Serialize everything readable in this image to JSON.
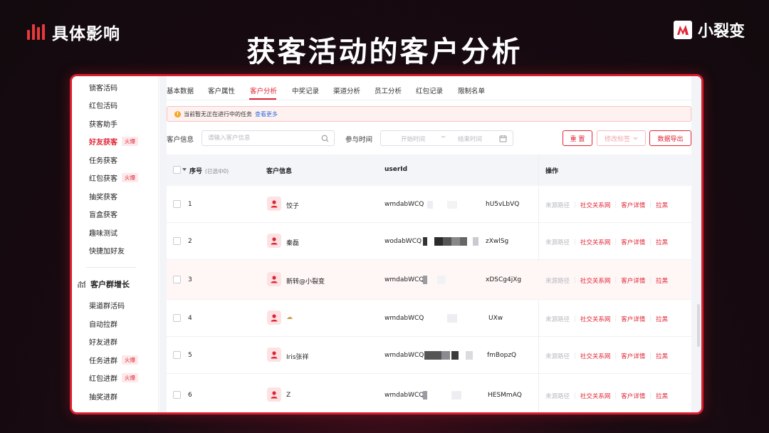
{
  "slide": {
    "brand_left": "具体影响",
    "title": "获客活动的客户分析",
    "brand_right": "小裂变"
  },
  "sidebar": {
    "items_top": [
      {
        "label": "锁客活码",
        "active": false,
        "hot": ""
      },
      {
        "label": "红包活码",
        "active": false,
        "hot": ""
      },
      {
        "label": "获客助手",
        "active": false,
        "hot": ""
      },
      {
        "label": "好友获客",
        "active": true,
        "hot": "火爆"
      },
      {
        "label": "任务获客",
        "active": false,
        "hot": ""
      },
      {
        "label": "红包获客",
        "active": false,
        "hot": "火爆"
      },
      {
        "label": "抽奖获客",
        "active": false,
        "hot": ""
      },
      {
        "label": "盲盒获客",
        "active": false,
        "hot": ""
      },
      {
        "label": "趣味测试",
        "active": false,
        "hot": ""
      },
      {
        "label": "快捷加好友",
        "active": false,
        "hot": ""
      }
    ],
    "group_title": "客户群增长",
    "items_bottom": [
      {
        "label": "渠道群活码",
        "hot": ""
      },
      {
        "label": "自动拉群",
        "hot": ""
      },
      {
        "label": "好友进群",
        "hot": ""
      },
      {
        "label": "任务进群",
        "hot": "火爆"
      },
      {
        "label": "红包进群",
        "hot": "火爆"
      },
      {
        "label": "抽奖进群",
        "hot": ""
      }
    ]
  },
  "tabs": [
    "基本数据",
    "客户属性",
    "客户分析",
    "中奖记录",
    "渠道分析",
    "员工分析",
    "红包记录",
    "限制名单"
  ],
  "active_tab": "客户分析",
  "notice": {
    "text": "当前暂无正在进行中的任务",
    "link": "查看更多"
  },
  "filters": {
    "customer_label": "客户信息",
    "customer_placeholder": "请输入客户信息",
    "time_label": "参与时间",
    "start_placeholder": "开始时间",
    "range_sep": "~",
    "end_placeholder": "结束时间"
  },
  "buttons": {
    "reset": "重 置",
    "edit_tag": "修改标签",
    "export": "数据导出"
  },
  "table": {
    "headers": {
      "index": "序号",
      "selected": "(已选中0)",
      "customer": "客户信息",
      "userid": "userId",
      "ops": "操作"
    },
    "rows": [
      {
        "index": "1",
        "name": "饺子",
        "uid_prefix": "wmdabWCQ",
        "uid_suffix": "hU5vLbVQ"
      },
      {
        "index": "2",
        "name": "秦磊",
        "uid_prefix": "wodabWCQ",
        "uid_suffix": "zXwlSg"
      },
      {
        "index": "3",
        "name": "新转@小裂变",
        "uid_prefix": "wmdabWCQ",
        "uid_suffix": "xDSCg4jXg"
      },
      {
        "index": "4",
        "name": "☁",
        "uid_prefix": "wmdabWCQ",
        "uid_suffix": "UXw"
      },
      {
        "index": "5",
        "name": "Iris张祥",
        "uid_prefix": "wmdabWCQ",
        "uid_suffix": "fmBopzQ"
      },
      {
        "index": "6",
        "name": "Z",
        "uid_prefix": "wmdabWCQ",
        "uid_suffix": "HESMmAQ"
      }
    ],
    "ops": {
      "source": "来源路径",
      "social": "社交关系网",
      "detail": "客户详情",
      "block": "拉黑",
      "sep": "|"
    }
  },
  "colors": {
    "accent": "#e02433",
    "window_border": "#d81e2f",
    "muted_op": "#b7bac1"
  }
}
